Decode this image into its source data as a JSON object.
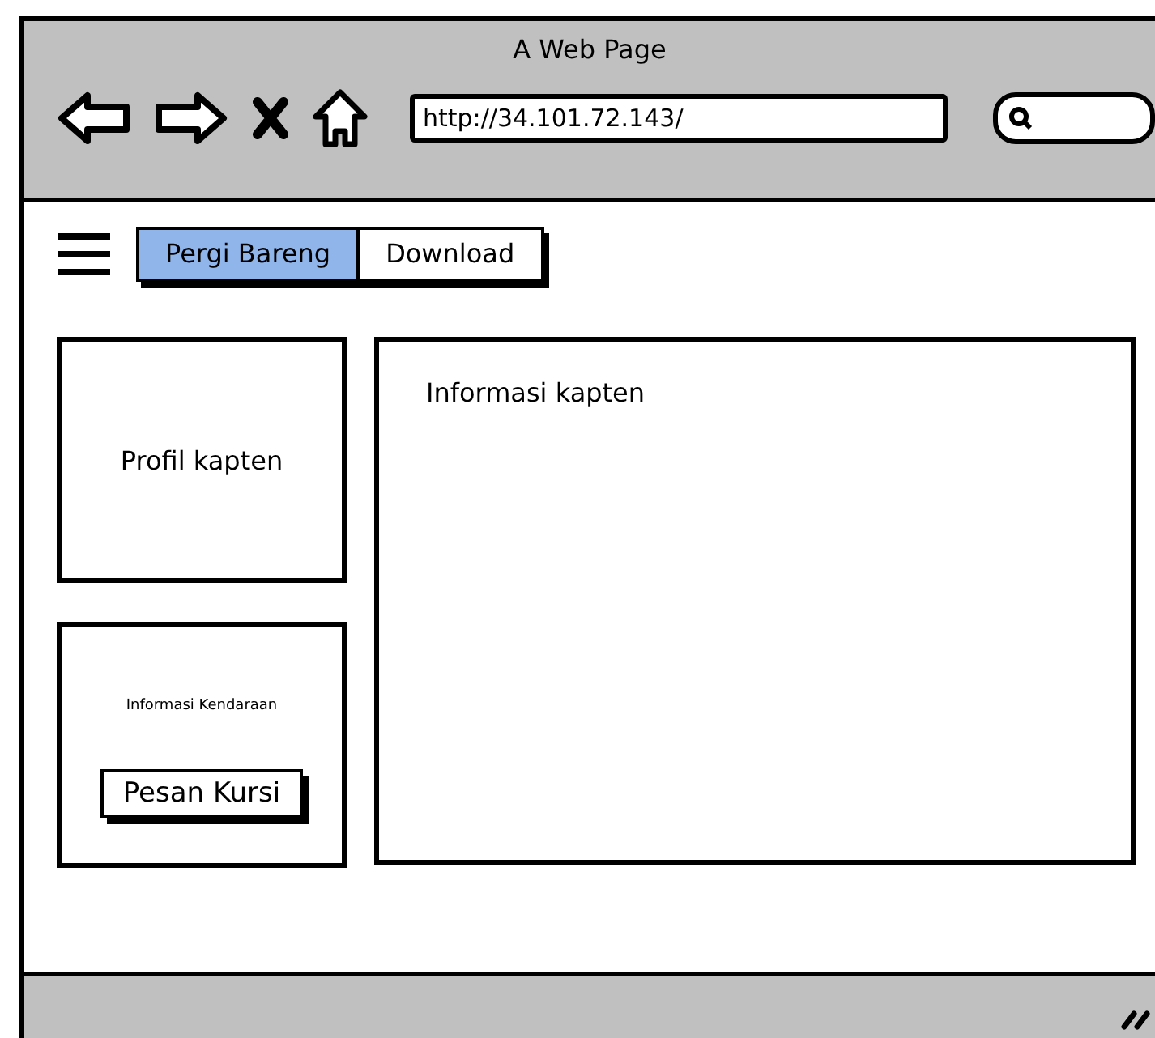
{
  "window": {
    "title": "A Web Page"
  },
  "address_bar": {
    "url": "http://34.101.72.143/"
  },
  "tabs": [
    {
      "label": "Pergi Bareng",
      "selected": true
    },
    {
      "label": "Download",
      "selected": false
    }
  ],
  "profile_panel": {
    "label": "Profil kapten"
  },
  "vehicle_panel": {
    "label": "Informasi Kendaraan",
    "button": "Pesan Kursi"
  },
  "main_panel": {
    "label": "Informasi kapten"
  }
}
